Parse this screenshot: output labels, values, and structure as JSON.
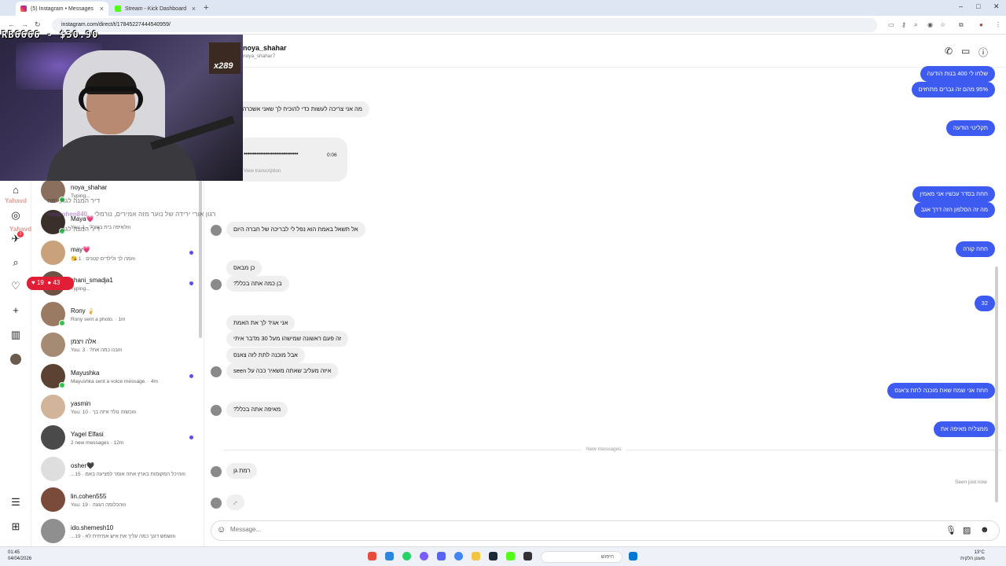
{
  "browser": {
    "tabs": [
      {
        "title": "(5) Instagram • Messages",
        "active": true
      },
      {
        "title": "Stream - Kick Dashboard",
        "active": false
      }
    ],
    "url": "instagram.com/direct/t/17845227444540959/"
  },
  "stream_overlay": {
    "donation": "RB6666 - $30.90",
    "badge": "x289",
    "viewers_hearts": "19",
    "viewers_people": "43",
    "chat_lines": [
      {
        "user": "Yahavd",
        "text": "דיר המנה לגוז, יפה"
      },
      {
        "user": "noacohen840",
        "text": "רגון אורי ירידה של נוער מזה אמירים, נורמלי"
      },
      {
        "user": "Yahavd",
        "text": "דיר המנה לגוז, יפה"
      }
    ]
  },
  "conversations": [
    {
      "name": "noya_shahar",
      "preview": "Typing...",
      "online": true,
      "unread": false,
      "color": "#8a6f5e"
    },
    {
      "name": "Maya💗",
      "preview": "You: לאיפה בית בעיר? · 1m",
      "online": true,
      "unread": false,
      "color": "#3a2f2a"
    },
    {
      "name": "may💗",
      "preview": "😘 מה לך ולילדים קטנים · 1m",
      "online": false,
      "unread": true,
      "color": "#c9a27c"
    },
    {
      "name": "shani_smadja1",
      "preview": "Typing...",
      "online": false,
      "unread": true,
      "color": "#6d5343"
    },
    {
      "name": "Rony 🍦",
      "preview": "Rony sent a photo. · 1m",
      "online": true,
      "unread": false,
      "color": "#9a7a62"
    },
    {
      "name": "אלה ויצמן",
      "preview": "You: בנו כמה את? · 3m",
      "online": false,
      "unread": false,
      "color": "#a58a74"
    },
    {
      "name": "Mayushka",
      "preview": "Mayushka sent a voice message. · 4m",
      "online": true,
      "unread": true,
      "color": "#5b4232"
    },
    {
      "name": "yasmin",
      "preview": "You: כשזה נולד איזה בך · 10m",
      "online": false,
      "unread": false,
      "color": "#d2b49a"
    },
    {
      "name": "Yagel Elfasi",
      "preview": "2 new messages · 12m",
      "online": false,
      "unread": true,
      "color": "#4a4a4a"
    },
    {
      "name": "osher🖤",
      "preview": "...היכל המקומות בארץ אתה אומר לפציעה באמ · 15m",
      "online": false,
      "unread": false,
      "color": "#dedede"
    },
    {
      "name": "lin.cohen555",
      "preview": "You: הכלומה הגעה · 19m",
      "online": false,
      "unread": false,
      "color": "#7a4a3a"
    },
    {
      "name": "ido.shemesh10",
      "preview": "...שמש דונך כמה עליך את איש אמיתית לא · 19m",
      "online": false,
      "unread": false,
      "color": "#8f8f8f"
    }
  ],
  "chat": {
    "name": "noya_shahar",
    "username": "noya_shahar7",
    "voice_duration": "0:06",
    "voice_transcription": "View transcription",
    "new_messages_label": "New messages",
    "seen_label": "Seen just now",
    "composer_placeholder": "Message..."
  },
  "messages": [
    {
      "dir": "out",
      "text": "שלחו לי 400 בנות הודעה"
    },
    {
      "dir": "out",
      "text": "95% מהם זה גברים מתחזים"
    },
    {
      "dir": "in",
      "text": "מה אני צריכה לעשות כדי להוכיח לך שאני אשכרה אני"
    },
    {
      "dir": "out",
      "text": "תקליטי הודעה"
    },
    {
      "dir": "out",
      "text": "חחח בסדר עכשיו אני מאמין"
    },
    {
      "dir": "out",
      "text": "מה זה הסלפון הזה דרך אגב"
    },
    {
      "dir": "in",
      "text": "אל תשאל באמת הוא נפל לי לבריכה של חברה היום"
    },
    {
      "dir": "out",
      "text": "חחח קורה"
    },
    {
      "dir": "in",
      "text": "כן מבאס"
    },
    {
      "dir": "in",
      "text": "בן כמה אתה בכלל?"
    },
    {
      "dir": "out",
      "text": "32"
    },
    {
      "dir": "in",
      "text": "אני אגיד לך את האמת"
    },
    {
      "dir": "in",
      "text": "זה פעם ראשונה שמישהו מעל 30 מדבר איתי"
    },
    {
      "dir": "in",
      "text": "אבל מוכנה לתת לזה צאנס"
    },
    {
      "dir": "in",
      "text": "איזה מעליב שאתה משאיר ככה על seen"
    },
    {
      "dir": "out",
      "text": "חחח אני שמח שאת מוכנה לתת צ'אנס"
    },
    {
      "dir": "in",
      "text": "מאיפה אתה בכלל?"
    },
    {
      "dir": "out",
      "text": "ממצליח מאיפה את"
    },
    {
      "dir": "in",
      "text": "רמת גן"
    },
    {
      "dir": "in",
      "text": "-,"
    }
  ],
  "taskbar": {
    "time": "01:45",
    "date": "04/04/2026",
    "search_placeholder": "חיפוש",
    "temperature": "13°C",
    "weather": "מעונן חלקית"
  },
  "colors": {
    "accent": "#3d5af1",
    "incoming": "#efefef",
    "online": "#31c54d",
    "unread": "#5850ec"
  }
}
